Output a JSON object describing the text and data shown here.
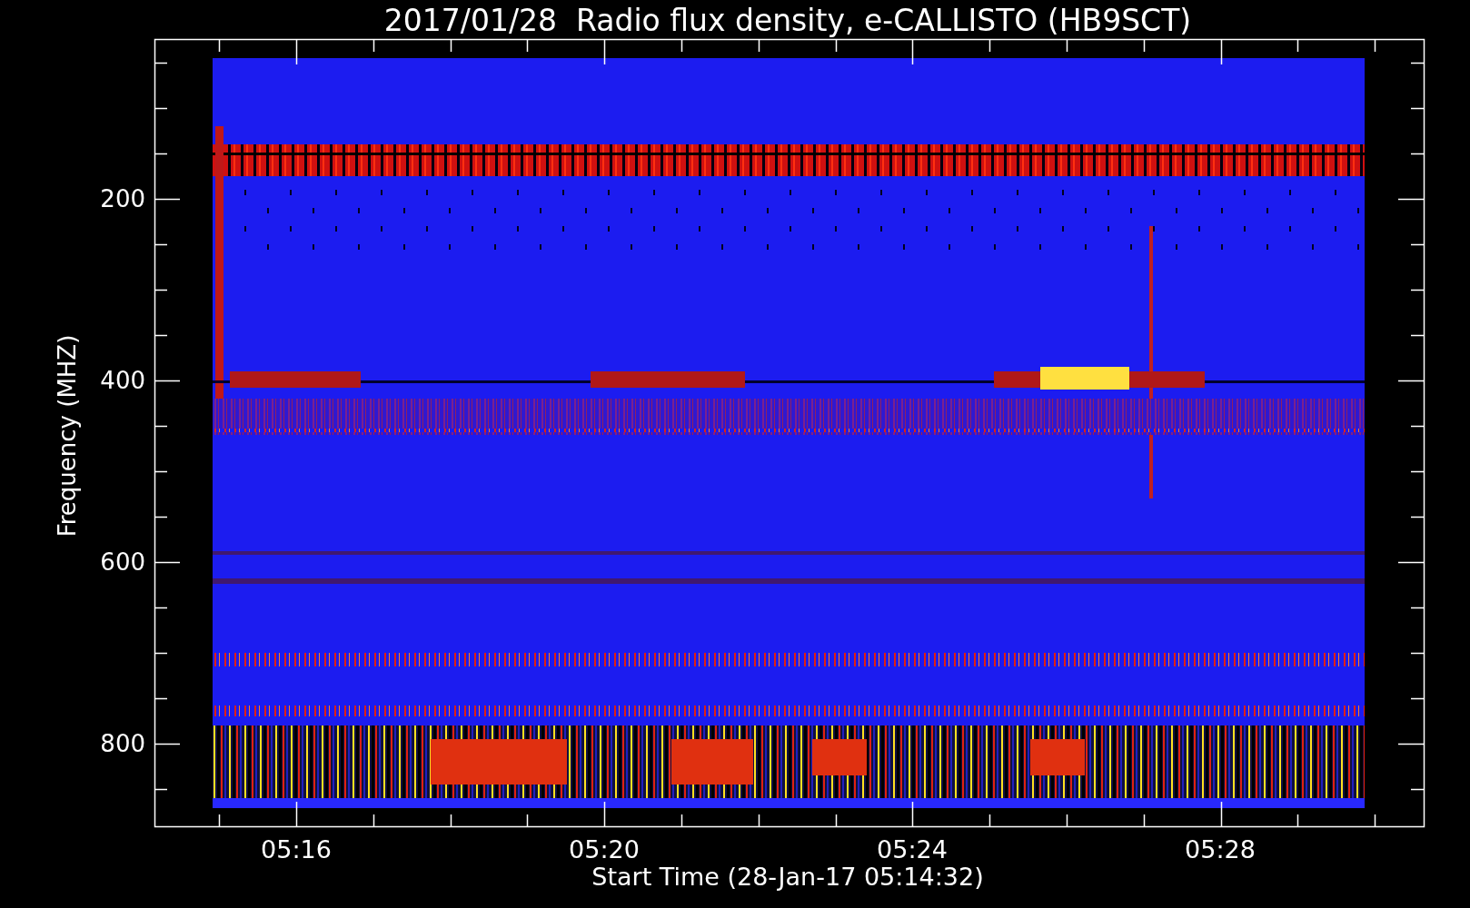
{
  "title": "2017/01/28  Radio flux density, e-CALLISTO (HB9SCT)",
  "y_axis": {
    "label": "Frequency (MHZ)",
    "ticks": [
      "200",
      "400",
      "600",
      "800"
    ]
  },
  "x_axis": {
    "label": "Start Time (28-Jan-17 05:14:32)",
    "ticks": [
      "05:16",
      "05:20",
      "05:24",
      "05:28"
    ]
  }
}
